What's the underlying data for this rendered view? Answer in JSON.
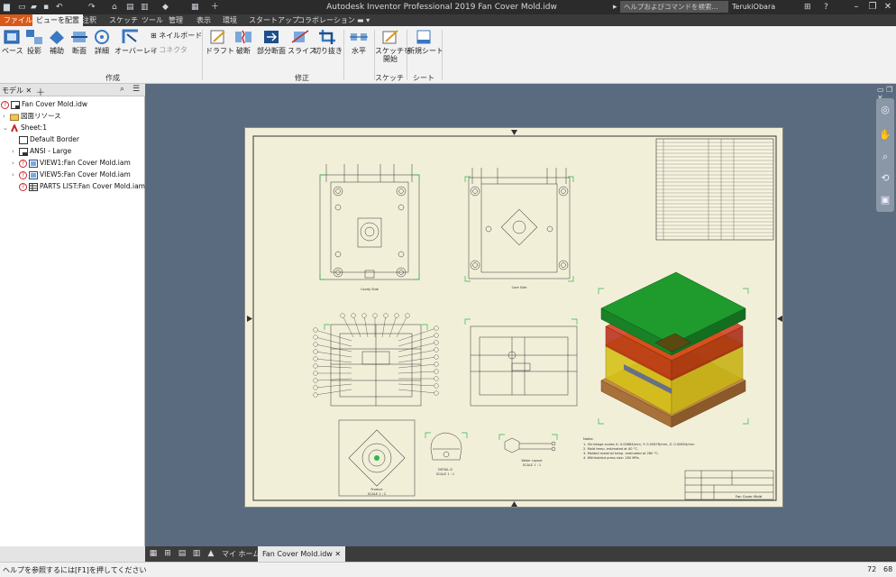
{
  "title_bar": {
    "title": "Autodesk Inventor Professional 2019    Fan Cover Mold.idw",
    "search_placeholder": "ヘルプおよびコマンドを検索...",
    "user": "TerukiObara"
  },
  "tabs": [
    "ファイル",
    "ビューを配置",
    "注釈",
    "スケッチ",
    "ツール",
    "管理",
    "表示",
    "環境",
    "スタートアップ",
    "コラボレーション"
  ],
  "ribbon": {
    "create": {
      "buttons": [
        "ベース",
        "投影",
        "補助",
        "断面",
        "詳細",
        "オーバーレイ"
      ],
      "small": [
        "ネイルボード",
        "コネクタ"
      ],
      "group_label": "作成"
    },
    "modify": {
      "buttons": [
        "ドラフト",
        "破断",
        "部分断面",
        "スライス",
        "切り抜き"
      ],
      "small": [
        "水平"
      ],
      "group_label": "修正"
    },
    "sketch": {
      "button_line1": "スケッチを",
      "button_line2": "開始",
      "group_label": "スケッチ"
    },
    "sheet": {
      "button": "新規シート",
      "group_label": "シート"
    }
  },
  "browser": {
    "tab_label": "モデル",
    "nodes": [
      {
        "label": "Fan Cover Mold.idw",
        "icon": "document-icon"
      },
      {
        "label": "図面リソース",
        "icon": "folder-icon"
      },
      {
        "label": "Sheet:1",
        "icon": "sheet-icon"
      },
      {
        "label": "Default Border",
        "icon": "border-icon"
      },
      {
        "label": "ANSI - Large",
        "icon": "title-block-icon"
      },
      {
        "label": "VIEW1:Fan Cover Mold.iam",
        "icon": "view-icon"
      },
      {
        "label": "VIEW5:Fan Cover Mold.iam",
        "icon": "view-icon"
      },
      {
        "label": "PARTS LIST:Fan Cover Mold.iam",
        "icon": "parts-list-icon"
      }
    ]
  },
  "drawing": {
    "view_labels": [
      "Cavity Side",
      "Core Side",
      "Product",
      "DETAIL D",
      "Water Layout"
    ],
    "scale_labels": [
      "SCALE 1 : 2",
      "SCALE 1 : 1",
      "SCALE 1 : 1"
    ],
    "notes_title": "Notes:",
    "notes": [
      "1. Shrinkage scales X: 0.00684/mm, Y: 0.00678/mm, Z: 0.00654/mm",
      "2. Mold temp. estimated at 40 °C.",
      "3. Molded material temp. estimated at 260 °C.",
      "4. Withholded press size: 180 MPa."
    ],
    "title_block_name": "Fan Cover Mold",
    "colors": {
      "paper": "#f2efd9",
      "iso_top": "#1f9a2c",
      "iso_red": "#d43a1c",
      "iso_yellow": "#e3d21e",
      "iso_base": "#c48a46"
    }
  },
  "bottom_tabs": [
    "マイ ホーム",
    "Fan Cover Mold.idw"
  ],
  "status": {
    "message": "ヘルプを参照するには[F1]を押してください",
    "count1": "72",
    "count2": "68"
  }
}
